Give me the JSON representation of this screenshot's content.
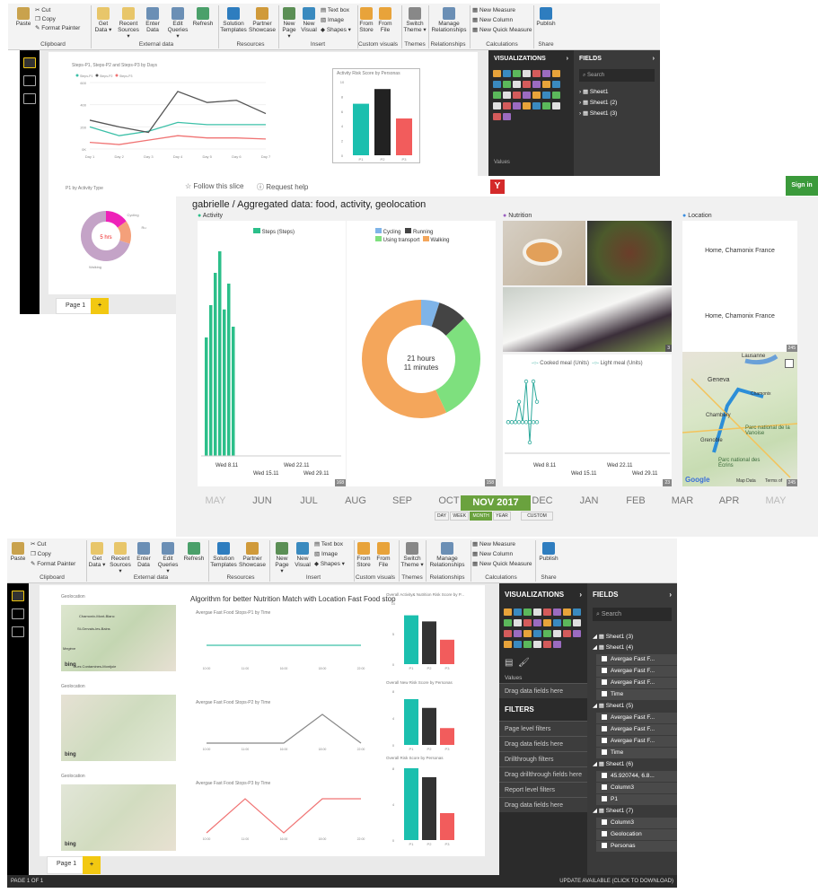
{
  "top": {
    "clipboard": {
      "paste": "Paste",
      "cut": "Cut",
      "copy": "Copy",
      "format_painter": "Format Painter",
      "group": "Clipboard"
    },
    "external": {
      "get_data": "Get Data ▾",
      "recent_sources": "Recent Sources ▾",
      "enter_data": "Enter Data",
      "edit_queries": "Edit Queries ▾",
      "refresh": "Refresh",
      "group": "External data"
    },
    "resources": {
      "solution_templates": "Solution Templates",
      "partner_showcase": "Partner Showcase",
      "group": "Resources"
    },
    "insert": {
      "new_page": "New Page ▾",
      "new_visual": "New Visual",
      "text_box": "Text box",
      "image": "Image",
      "shapes": "Shapes ▾",
      "group": "Insert"
    },
    "custom": {
      "from_store": "From Store",
      "from_file": "From File",
      "group": "Custom visuals"
    },
    "themes": {
      "switch_theme": "Switch Theme ▾",
      "group": "Themes"
    },
    "relationships": {
      "manage": "Manage Relationships",
      "group": "Relationships"
    },
    "calculations": {
      "new_measure": "New Measure",
      "new_column": "New Column",
      "new_quick_measure": "New Quick Measure",
      "group": "Calculations"
    },
    "share": {
      "publish": "Publish",
      "group": "Share"
    },
    "viz_title": "VISUALIZATIONS",
    "fields_title": "FIELDS",
    "search_placeholder": "Search",
    "fields": [
      "Sheet1",
      "Sheet1 (2)",
      "Sheet1 (3)"
    ],
    "values_label": "Values",
    "page_tab": "Page 1",
    "plus": "+",
    "line_chart": {
      "title": "Steps-P1, Steps-P2 and Steps-P3 by Days",
      "legend": [
        "Steps-P1",
        "Steps-P2",
        "Steps-P3"
      ],
      "y_ticks": [
        "600",
        "400",
        "200",
        "0K"
      ],
      "x_ticks": [
        "Day 1",
        "Day 2",
        "Day 3",
        "Day 4",
        "Day 5",
        "Day 6",
        "Day 7"
      ]
    },
    "bar_chart": {
      "title": "Activity Risk Score by Personas",
      "y_ticks": [
        "10",
        "8",
        "6",
        "4",
        "2",
        "0"
      ],
      "x_ticks": [
        "P1",
        "P2",
        "P3"
      ]
    },
    "donut": {
      "title": "P1 by Activity Type",
      "center": "5 hrs",
      "labels": [
        "Cycling",
        "Ru",
        "Walking"
      ]
    }
  },
  "mid": {
    "follow": "Follow this slice",
    "request_help": "Request help",
    "sign_in": "Sign in",
    "title": "gabrielle / Aggregated data: food, activity, geolocation",
    "sections": {
      "activity": "Activity",
      "nutrition": "Nutrition",
      "location": "Location"
    },
    "steps_legend": "Steps (Steps)",
    "steps_dates": [
      "Wed 8.11",
      "Wed 15.11",
      "Wed 22.11",
      "Wed 29.11"
    ],
    "steps_count": "168",
    "donut_legend": [
      "Cycling",
      "Running",
      "Using transport",
      "Walking"
    ],
    "donut_center_line1": "21 hours",
    "donut_center_line2": "11 minutes",
    "donut_count": "158",
    "photo_count": "3",
    "meal_legend": [
      "Cooked meal (Units)",
      "Light meal (Units)"
    ],
    "meal_dates": [
      "Wed 8.11",
      "Wed 15.11",
      "Wed 22.11",
      "Wed 29.11"
    ],
    "meal_count": "23",
    "locations": [
      "Home, Chamonix France",
      "Home, Chamonix France"
    ],
    "loc_count": "245",
    "map_count": "245",
    "map_labels": [
      "Lausanne",
      "Geneva",
      "Chamonix",
      "Chambéry",
      "Grenoble",
      "Parc national de la Vanoise",
      "Parc national des Écrins",
      "Google",
      "Map Data",
      "Terms of"
    ],
    "months": [
      "MAY",
      "JUN",
      "JUL",
      "AUG",
      "SEP",
      "OCT",
      "NOV 2017",
      "DEC",
      "JAN",
      "FEB",
      "MAR",
      "APR",
      "MAY"
    ],
    "range_tabs": [
      "DAY",
      "WEEK",
      "MONTH",
      "YEAR",
      "CUSTOM"
    ]
  },
  "bottom": {
    "card_titles": [
      "Geolocation",
      "Geolocation",
      "Geolocation"
    ],
    "algo_title": "Algorithm for better Nutrition Match with Location Fast Food stop",
    "line_titles": [
      "Avergae Fast Food Stops-P1 by Time",
      "Avergae Fast Food Stops-P2 by Time",
      "Avergae Fast Food Stops-P3 by Time"
    ],
    "x_ticks": [
      "10:00",
      "11:00",
      "16:00",
      "18:00",
      "22:00"
    ],
    "bar_titles": [
      "Overall Activity& Nutrition Risk Score by P...",
      "Overall New Risk Score by Personas",
      "Overall Risk Score by Personas"
    ],
    "bar_x": [
      "P1",
      "P2",
      "P3"
    ],
    "viz_title": "VISUALIZATIONS",
    "fields_title": "FIELDS",
    "search_placeholder": "Search",
    "values_label": "Values",
    "drag_here": "Drag data fields here",
    "filters_title": "FILTERS",
    "filters": [
      "Page level filters",
      "Drag data fields here",
      "Drillthrough filters",
      "Drag drillthrough fields here",
      "Report level filters",
      "Drag data fields here"
    ],
    "fields_tree": [
      "Sheet1 (3)",
      "Sheet1 (4)",
      "Avergae Fast F...",
      "Avergae Fast F...",
      "Avergae Fast F...",
      "Time",
      "Sheet1 (5)",
      "Avergae Fast F...",
      "Avergae Fast F...",
      "Avergae Fast F...",
      "Time",
      "Sheet1 (6)",
      "45.920744, 6.8...",
      "Column3",
      "P1",
      "Sheet1 (7)",
      "Column3",
      "Geolocation",
      "Personas"
    ],
    "page_tab": "Page 1",
    "plus": "+",
    "status_left": "PAGE 1 OF 1",
    "status_right": "UPDATE AVAILABLE (CLICK TO DOWNLOAD)",
    "bing": "bing",
    "map_place": [
      "Chamonix-Mont-Blanc",
      "St-Gervais-les-Bains",
      "Megève",
      "Les Contamines-Montjoie"
    ]
  },
  "chart_data": [
    {
      "type": "line",
      "title": "Steps-P1, Steps-P2 and Steps-P3 by Days",
      "categories": [
        "Day 1",
        "Day 2",
        "Day 3",
        "Day 4",
        "Day 5",
        "Day 6",
        "Day 7"
      ],
      "series": [
        {
          "name": "Steps-P1",
          "values": [
            200,
            120,
            160,
            240,
            220,
            220,
            220
          ]
        },
        {
          "name": "Steps-P2",
          "values": [
            260,
            200,
            150,
            520,
            420,
            440,
            320
          ]
        },
        {
          "name": "Steps-P3",
          "values": [
            60,
            40,
            80,
            120,
            100,
            100,
            90
          ]
        }
      ],
      "ylim": [
        0,
        600
      ]
    },
    {
      "type": "bar",
      "title": "Activity Risk Score by Personas",
      "categories": [
        "P1",
        "P2",
        "P3"
      ],
      "values": [
        7,
        9,
        5
      ],
      "ylim": [
        0,
        10
      ]
    },
    {
      "type": "pie",
      "title": "P1 by Activity Type",
      "categories": [
        "Cycling",
        "Ru",
        "Walking"
      ],
      "values": [
        0.15,
        0.15,
        0.7
      ]
    },
    {
      "type": "bar",
      "title": "Steps (Steps)",
      "values": [
        55,
        70,
        85,
        95,
        68,
        80,
        60
      ]
    },
    {
      "type": "pie",
      "categories": [
        "Cycling",
        "Running",
        "Using transport",
        "Walking"
      ],
      "values": [
        0.05,
        0.08,
        0.3,
        0.57
      ]
    },
    {
      "type": "line",
      "series": [
        {
          "name": "Cooked meal (Units)",
          "values": [
            1,
            1,
            1,
            2,
            1,
            3,
            0,
            3,
            2
          ]
        },
        {
          "name": "Light meal (Units)",
          "values": [
            1,
            1,
            1,
            1,
            1,
            1,
            1,
            1,
            1
          ]
        }
      ]
    },
    {
      "type": "line",
      "title": "Avergae Fast Food Stops-P1 by Time",
      "categories": [
        "10:00",
        "11:00",
        "16:00",
        "18:00",
        "22:00"
      ],
      "values": [
        1,
        1,
        1,
        1,
        1
      ],
      "ylim": [
        0,
        2
      ]
    },
    {
      "type": "line",
      "title": "Avergae Fast Food Stops-P2 by Time",
      "categories": [
        "10:00",
        "11:00",
        "16:00",
        "18:00",
        "22:00"
      ],
      "values": [
        0,
        0,
        0,
        1,
        0
      ],
      "ylim": [
        0,
        1
      ]
    },
    {
      "type": "line",
      "title": "Avergae Fast Food Stops-P3 by Time",
      "categories": [
        "10:00",
        "11:00",
        "16:00",
        "18:00",
        "22:00"
      ],
      "values": [
        0,
        1,
        0,
        1,
        1
      ],
      "ylim": [
        0,
        1
      ]
    },
    {
      "type": "bar",
      "title": "Overall Activity& Nutrition Risk Score by P...",
      "categories": [
        "P1",
        "P2",
        "P3"
      ],
      "values": [
        8,
        7,
        4
      ],
      "ylim": [
        0,
        10
      ]
    },
    {
      "type": "bar",
      "title": "Overall New Risk Score by Personas",
      "categories": [
        "P1",
        "P2",
        "P3"
      ],
      "values": [
        6.8,
        5.5,
        2.5
      ],
      "ylim": [
        0,
        8
      ]
    },
    {
      "type": "bar",
      "title": "Overall Risk Score by Personas",
      "categories": [
        "P1",
        "P2",
        "P3"
      ],
      "values": [
        8,
        7,
        3
      ],
      "ylim": [
        0,
        8
      ]
    }
  ]
}
